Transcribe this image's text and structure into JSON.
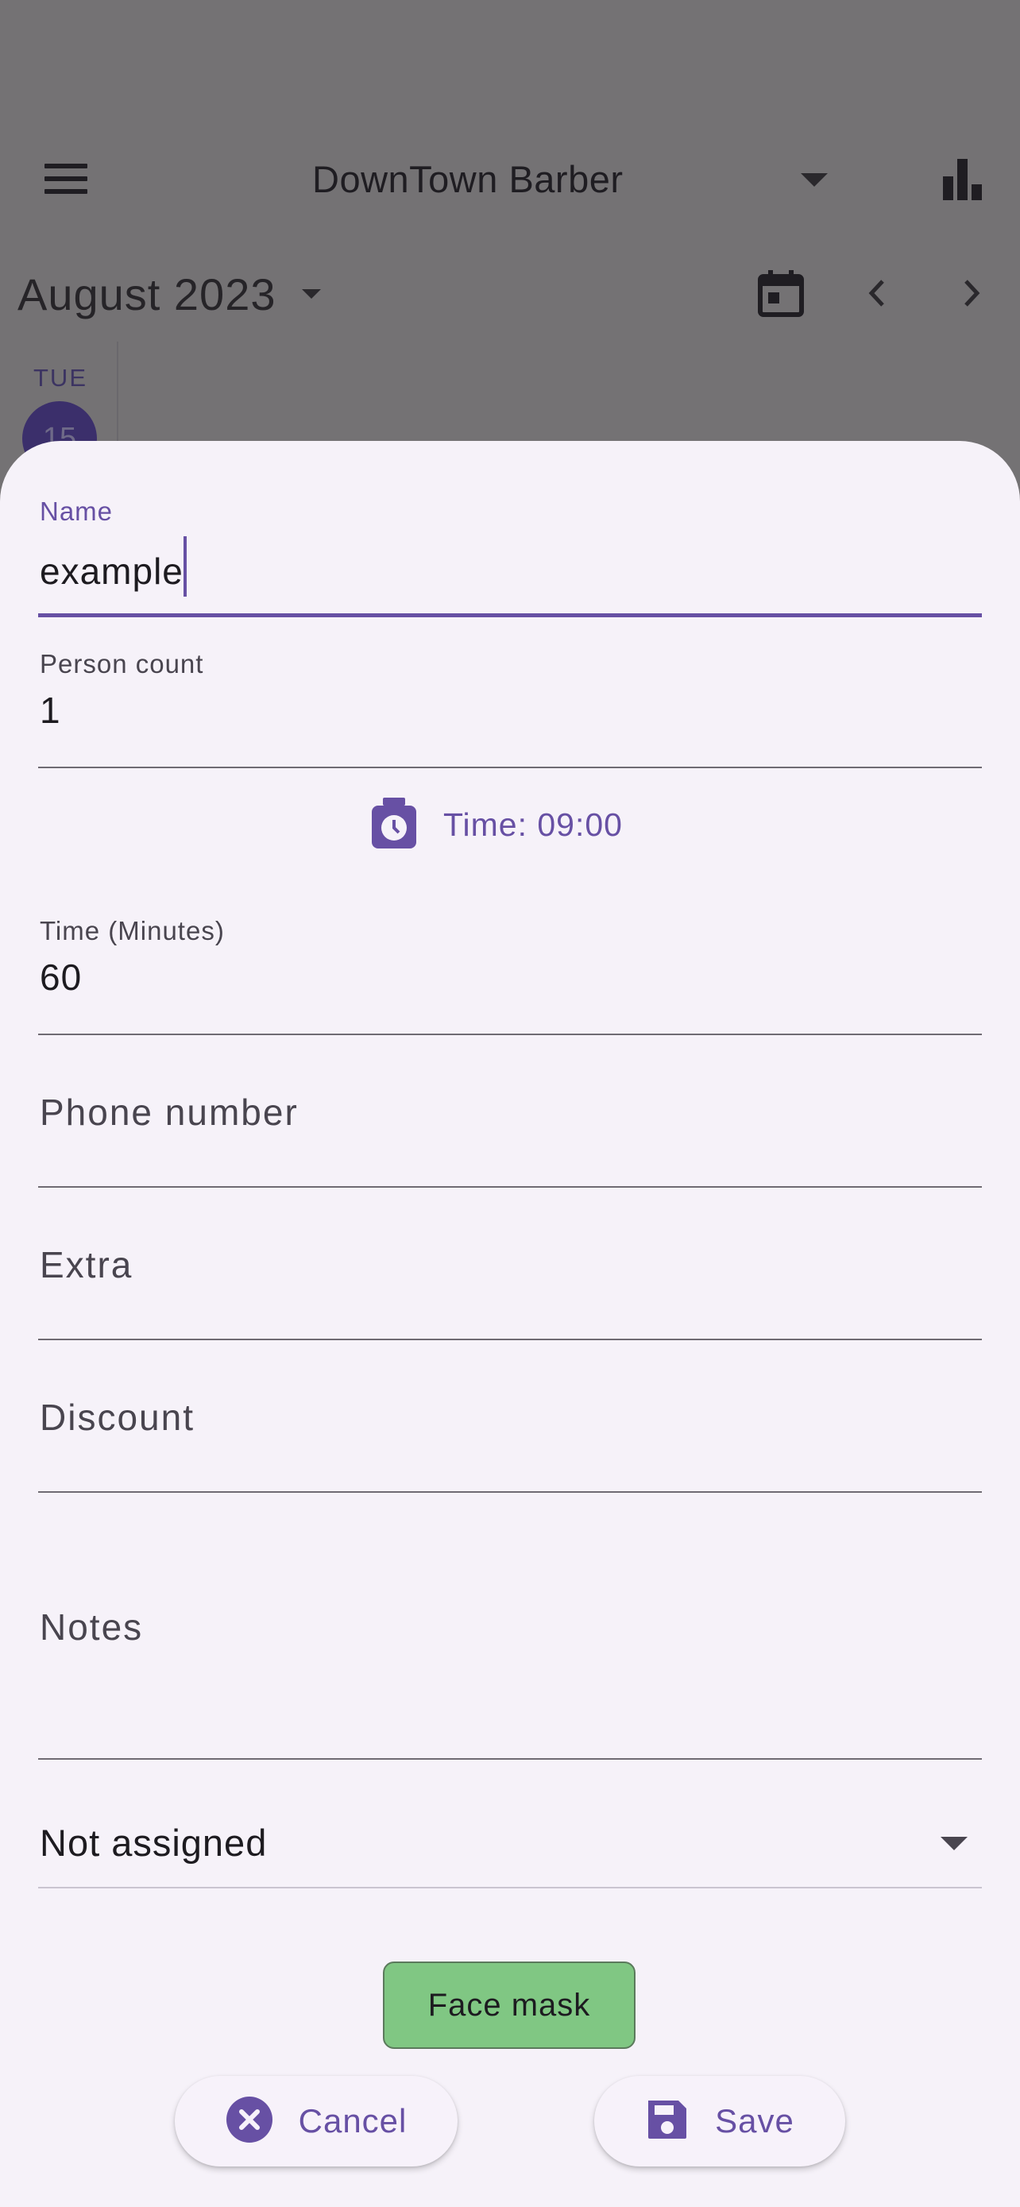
{
  "app_bar": {
    "title": "DownTown Barber",
    "menu_icon": "menu-icon",
    "stats_icon": "bar-chart-icon"
  },
  "calendar": {
    "month_label": "August 2023",
    "day_name": "TUE",
    "day_number": "15"
  },
  "form": {
    "name": {
      "label": "Name",
      "value": "example"
    },
    "person_count": {
      "label": "Person count",
      "value": "1"
    },
    "time_button": {
      "label": "Time: 09:00",
      "icon": "timer-icon"
    },
    "duration": {
      "label": "Time (Minutes)",
      "value": "60"
    },
    "phone": {
      "placeholder": "Phone number"
    },
    "extra": {
      "placeholder": "Extra"
    },
    "discount": {
      "placeholder": "Discount"
    },
    "notes": {
      "placeholder": "Notes"
    },
    "assignee": {
      "value": "Not assigned"
    },
    "chip": {
      "label": "Face mask"
    }
  },
  "actions": {
    "cancel_label": "Cancel",
    "save_label": "Save"
  },
  "colors": {
    "accent": "#6750a4",
    "chip_bg": "#80c783",
    "sheet_bg": "#f6f2f9",
    "scrim": "#747274"
  }
}
